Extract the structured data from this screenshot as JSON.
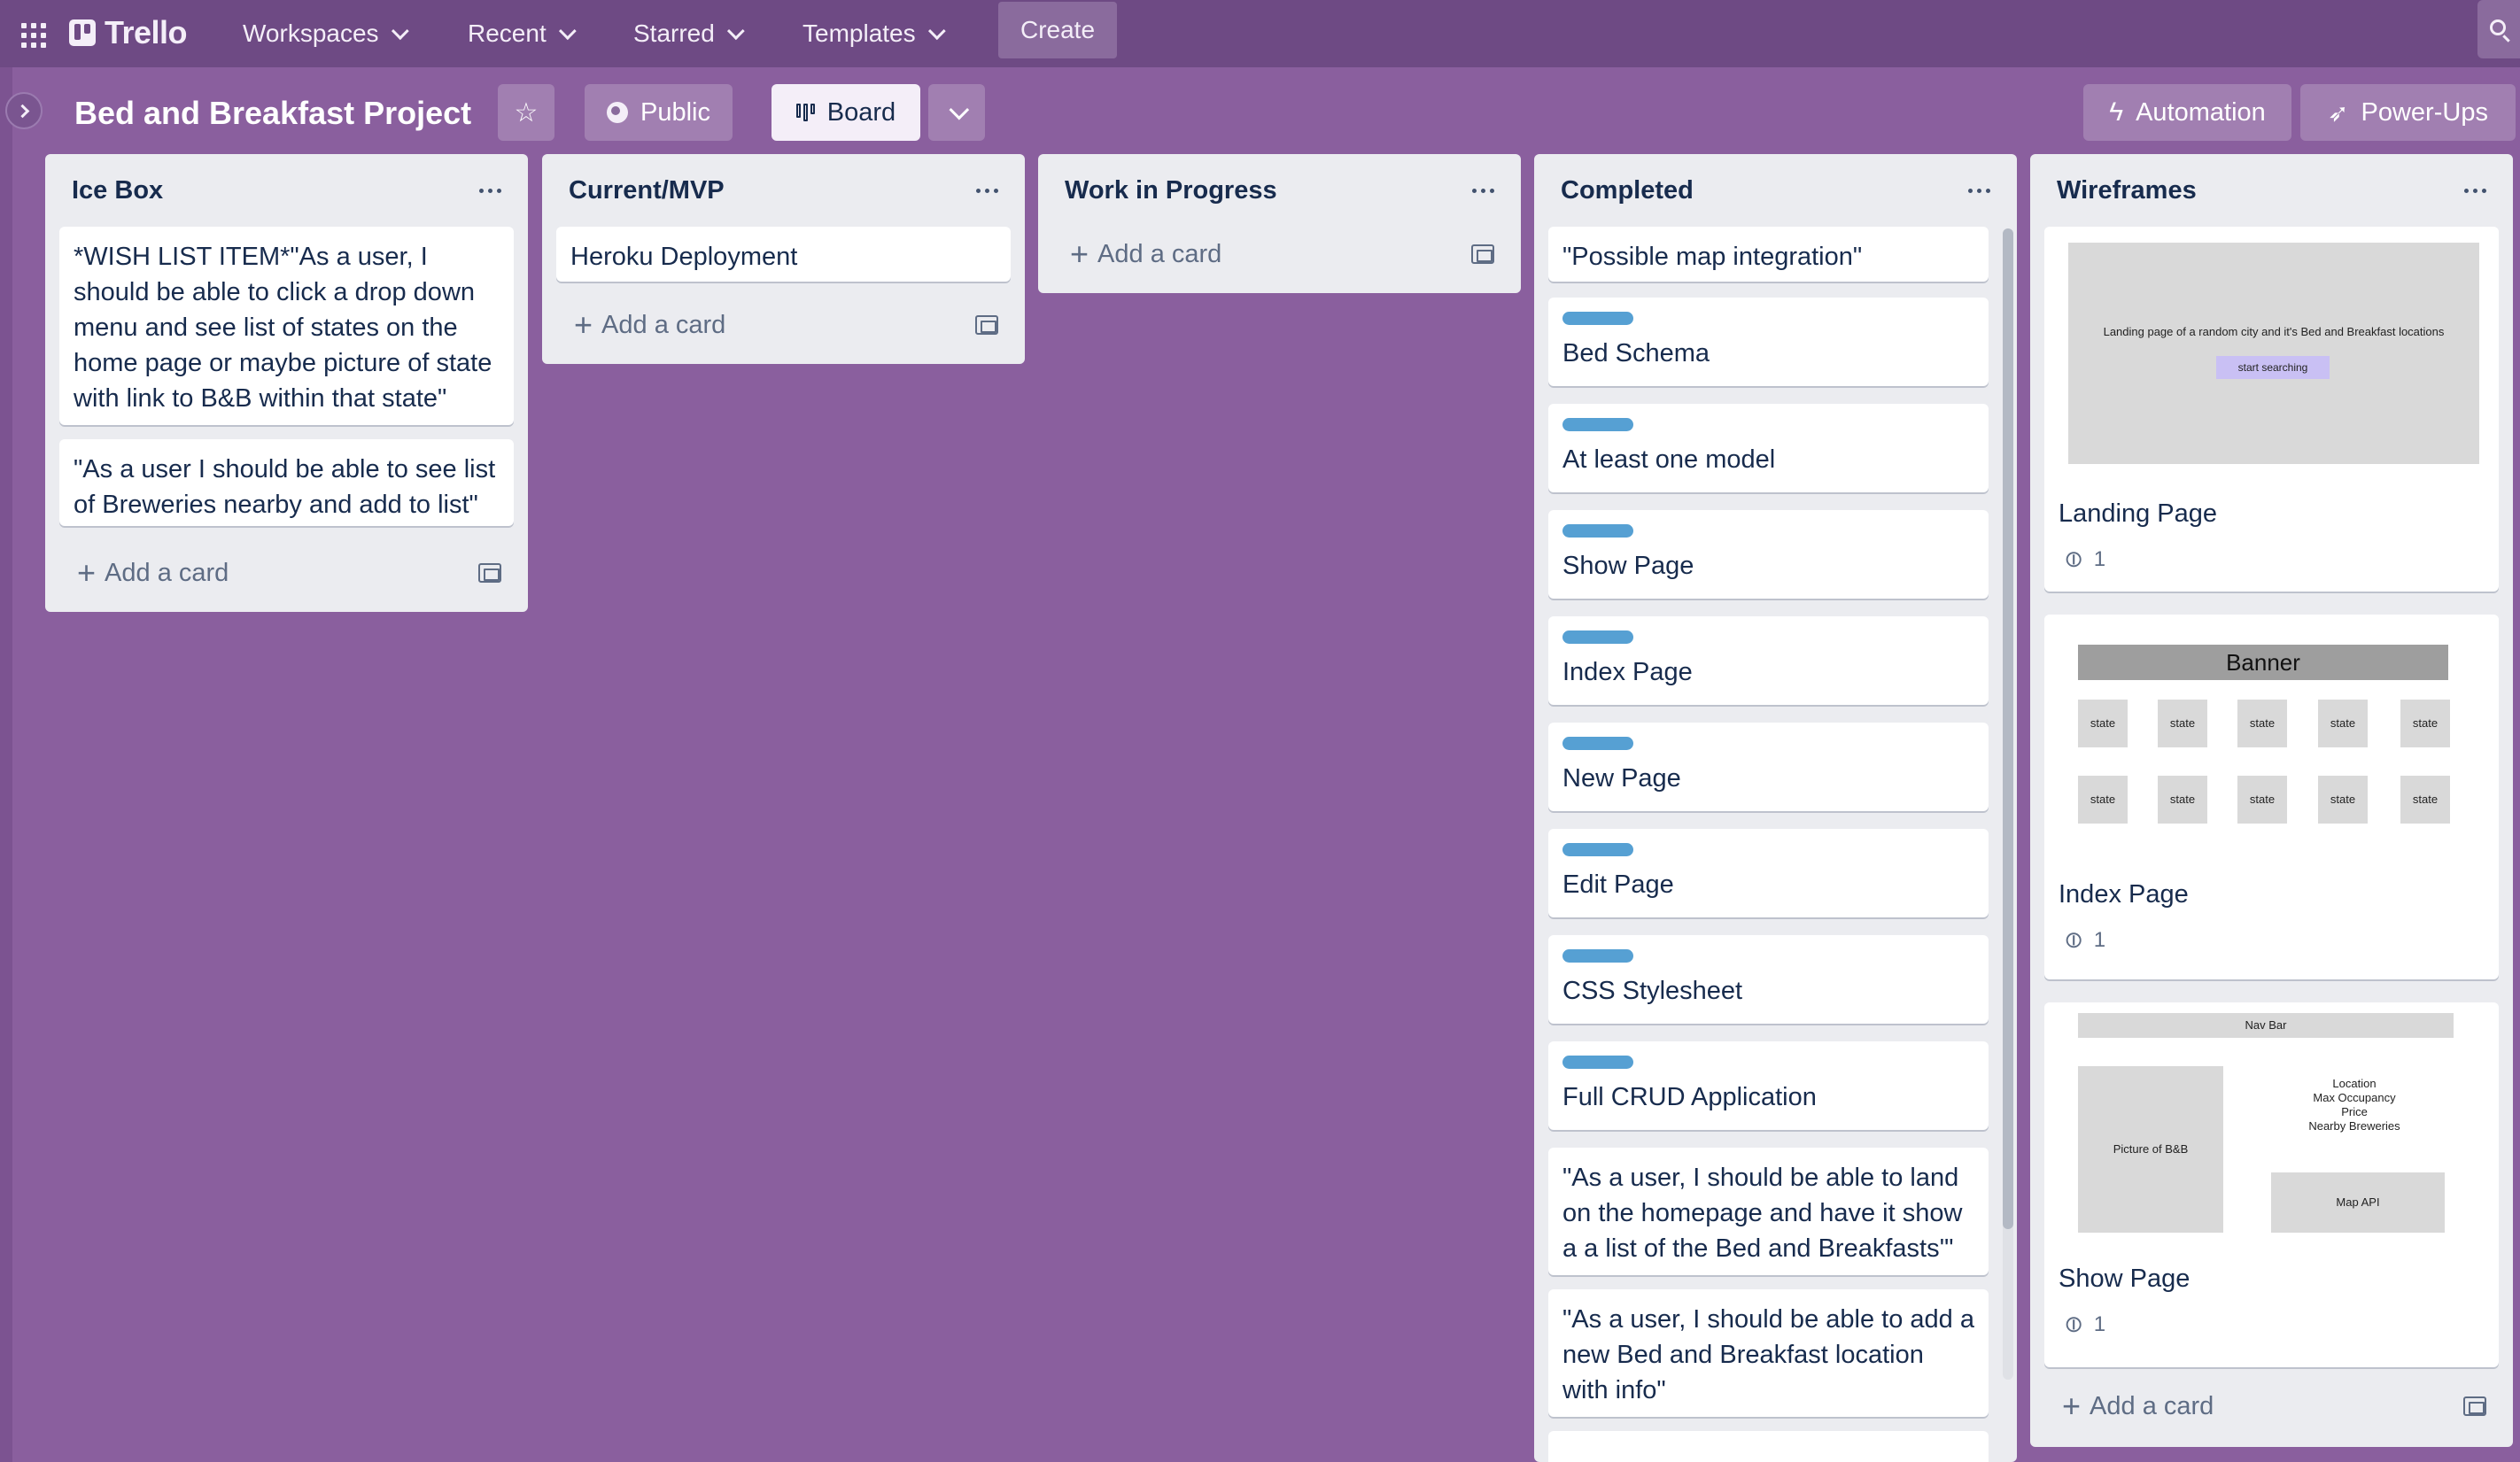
{
  "nav": {
    "logo": "Trello",
    "items": [
      {
        "label": "Workspaces"
      },
      {
        "label": "Recent"
      },
      {
        "label": "Starred"
      },
      {
        "label": "Templates"
      }
    ],
    "create": "Create"
  },
  "board": {
    "title": "Bed and Breakfast Project",
    "visibility": "Public",
    "view": "Board",
    "automation": "Automation",
    "powerups": "Power-Ups"
  },
  "lists": {
    "icebox": {
      "title": "Ice Box",
      "cards": [
        "*WISH LIST ITEM*\"As a user, I should be able to click a drop down menu and see list of states on the home page or maybe picture of state with link to B&B within that state\"",
        "\"As a user I should be able to see list of Breweries nearby and add to list\""
      ],
      "add": "Add a card"
    },
    "mvp": {
      "title": "Current/MVP",
      "cards": [
        "Heroku Deployment"
      ],
      "add": "Add a card"
    },
    "wip": {
      "title": "Work in Progress",
      "add": "Add a card"
    },
    "completed": {
      "title": "Completed",
      "label_color": "#56a0d3",
      "cards": [
        "\"Possible map integration\"",
        "Bed Schema",
        "At least one model",
        "Show Page",
        "Index Page",
        "New Page",
        "Edit Page",
        "CSS Stylesheet",
        "Full CRUD Application",
        "\"As a user, I should be able to land on the homepage and have it show a a list of the Bed and Breakfasts'\"",
        "\"As a user, I should be able to add a new Bed and Breakfast location with info\""
      ]
    },
    "wireframes": {
      "title": "Wireframes",
      "cards": [
        {
          "title": "Landing Page",
          "attachments": "1"
        },
        {
          "title": "Index Page",
          "attachments": "1"
        },
        {
          "title": "Show Page",
          "attachments": "1"
        }
      ],
      "landing": {
        "text": "Landing page of a random city and it's Bed and Breakfast locations",
        "button": "start searching"
      },
      "index": {
        "banner": "Banner",
        "tile": "state"
      },
      "show": {
        "navbar": "Nav Bar",
        "picture": "Picture of B&B",
        "details": [
          "Location",
          "Max Occupancy",
          "Price",
          "Nearby Breweries"
        ],
        "map": "Map API"
      },
      "add": "Add a card"
    }
  },
  "colors": {
    "board_bg": "#8a5f9e",
    "nav_bg": "#6e4a84",
    "list_bg": "#ebecf0",
    "label_blue": "#56a0d3"
  }
}
